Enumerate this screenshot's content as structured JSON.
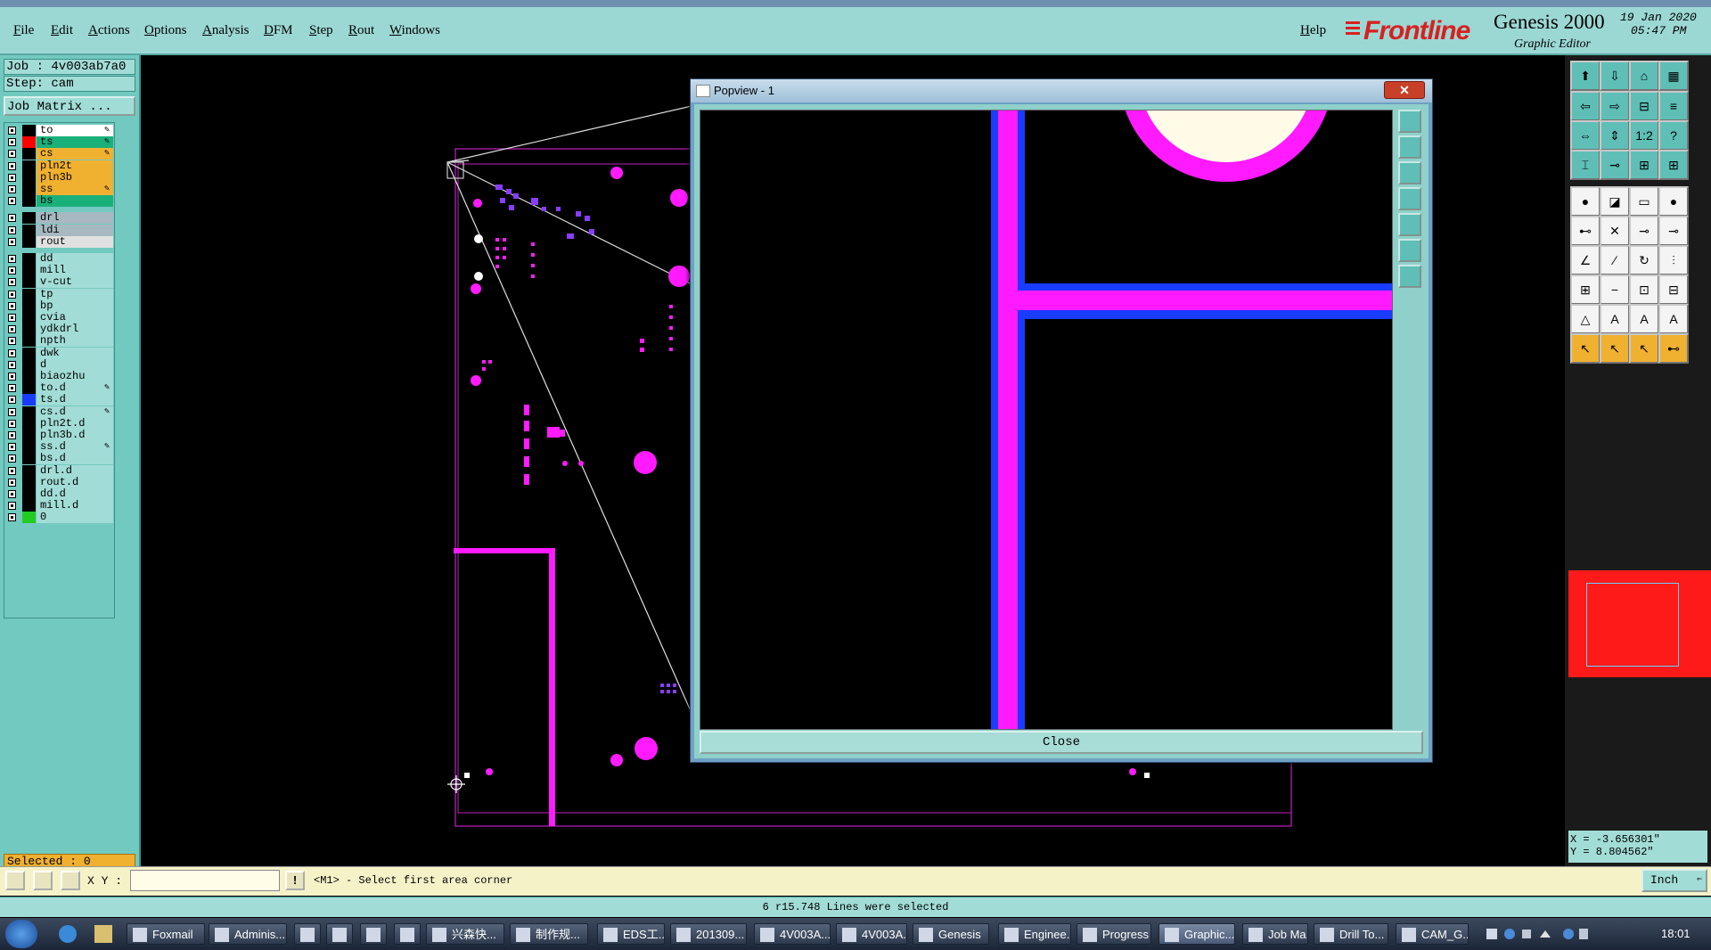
{
  "menu": [
    "File",
    "Edit",
    "Actions",
    "Options",
    "Analysis",
    "DFM",
    "Step",
    "Rout",
    "Windows"
  ],
  "help": "Help",
  "brand": {
    "logo": "Frontline",
    "product": "Genesis 2000",
    "subtitle": "Graphic Editor",
    "date": "19 Jan 2020",
    "time": "05:47 PM"
  },
  "job": {
    "job_label": "Job : 4v003ab7a0",
    "step_label": "Step: cam",
    "matrix_button": "Job Matrix ..."
  },
  "layers": [
    {
      "name": "to",
      "color": "#ffffff",
      "swatch": "#000000",
      "pen": true
    },
    {
      "name": "ts",
      "color": "#1ab07a",
      "swatch": "#ff0000",
      "pen": true
    },
    {
      "name": "cs",
      "color": "#f0b030",
      "swatch": "#000000",
      "pen": true
    },
    {
      "name": "pln2t",
      "color": "#f0b030",
      "swatch": "#000000",
      "pen": false
    },
    {
      "name": "pln3b",
      "color": "#f0b030",
      "swatch": "#000000",
      "pen": false
    },
    {
      "name": "ss",
      "color": "#f0b030",
      "swatch": "#000000",
      "pen": true
    },
    {
      "name": "bs",
      "color": "#1ab07a",
      "swatch": "#000000",
      "pen": false
    },
    {
      "name": "drl",
      "color": "#a8b8c0",
      "swatch": "#000000",
      "pen": false
    },
    {
      "name": "ldi",
      "color": "#a8b8c0",
      "swatch": "#000000",
      "pen": false
    },
    {
      "name": "rout",
      "color": "#e0e0e0",
      "swatch": "#000000",
      "pen": false
    },
    {
      "name": "dd",
      "color": "#a2dcd6",
      "swatch": "#000000",
      "pen": false
    },
    {
      "name": "mill",
      "color": "#a2dcd6",
      "swatch": "#000000",
      "pen": false
    },
    {
      "name": "v-cut",
      "color": "#a2dcd6",
      "swatch": "#000000",
      "pen": false
    },
    {
      "name": "tp",
      "color": "#a2dcd6",
      "swatch": "#000000",
      "pen": false
    },
    {
      "name": "bp",
      "color": "#a2dcd6",
      "swatch": "#000000",
      "pen": false
    },
    {
      "name": "cvia",
      "color": "#a2dcd6",
      "swatch": "#000000",
      "pen": false
    },
    {
      "name": "ydkdrl",
      "color": "#a2dcd6",
      "swatch": "#000000",
      "pen": false
    },
    {
      "name": "npth",
      "color": "#a2dcd6",
      "swatch": "#000000",
      "pen": false
    },
    {
      "name": "dwk",
      "color": "#a2dcd6",
      "swatch": "#000000",
      "pen": false
    },
    {
      "name": "d",
      "color": "#a2dcd6",
      "swatch": "#000000",
      "pen": false
    },
    {
      "name": "biaozhu",
      "color": "#a2dcd6",
      "swatch": "#000000",
      "pen": false
    },
    {
      "name": "to.d",
      "color": "#a2dcd6",
      "swatch": "#000000",
      "pen": true
    },
    {
      "name": "ts.d",
      "color": "#a2dcd6",
      "swatch": "#1a3cff",
      "pen": false
    },
    {
      "name": "cs.d",
      "color": "#a2dcd6",
      "swatch": "#000000",
      "pen": true
    },
    {
      "name": "pln2t.d",
      "color": "#a2dcd6",
      "swatch": "#000000",
      "pen": false
    },
    {
      "name": "pln3b.d",
      "color": "#a2dcd6",
      "swatch": "#000000",
      "pen": false
    },
    {
      "name": "ss.d",
      "color": "#a2dcd6",
      "swatch": "#000000",
      "pen": true
    },
    {
      "name": "bs.d",
      "color": "#a2dcd6",
      "swatch": "#000000",
      "pen": false
    },
    {
      "name": "drl.d",
      "color": "#a2dcd6",
      "swatch": "#000000",
      "pen": false
    },
    {
      "name": "rout.d",
      "color": "#a2dcd6",
      "swatch": "#000000",
      "pen": false
    },
    {
      "name": "dd.d",
      "color": "#a2dcd6",
      "swatch": "#000000",
      "pen": false
    },
    {
      "name": "mill.d",
      "color": "#a2dcd6",
      "swatch": "#000000",
      "pen": false
    },
    {
      "name": "0",
      "color": "#a2dcd6",
      "swatch": "#22cc22",
      "pen": false
    }
  ],
  "selected": "Selected : 0",
  "popview": {
    "title": "Popview - 1",
    "close_label": "Close"
  },
  "coords": {
    "x": "X = -3.656301\"",
    "y": "Y = 8.804562\""
  },
  "command": {
    "xy_label": "X Y :",
    "input_value": "",
    "prompt": "<M1> - Select first area corner",
    "units": "Inch"
  },
  "status": "6 r15.748 Lines were selected",
  "taskbar": {
    "items": [
      "Foxmail",
      "Adminis...",
      "",
      "",
      "",
      "",
      "兴森快...",
      "制作规...",
      "EDS工...",
      "201309...",
      "4V003A...",
      "4V003A...",
      "Genesis",
      "Enginee...",
      "Progress",
      "Graphic...",
      "Job Ma...",
      "Drill To...",
      "CAM_G..."
    ],
    "clock": "18:01"
  },
  "colors": {
    "magenta": "#ff1aff",
    "blue": "#1a3cff",
    "cream": "#fffbe6",
    "teal": "#72c9bf"
  }
}
